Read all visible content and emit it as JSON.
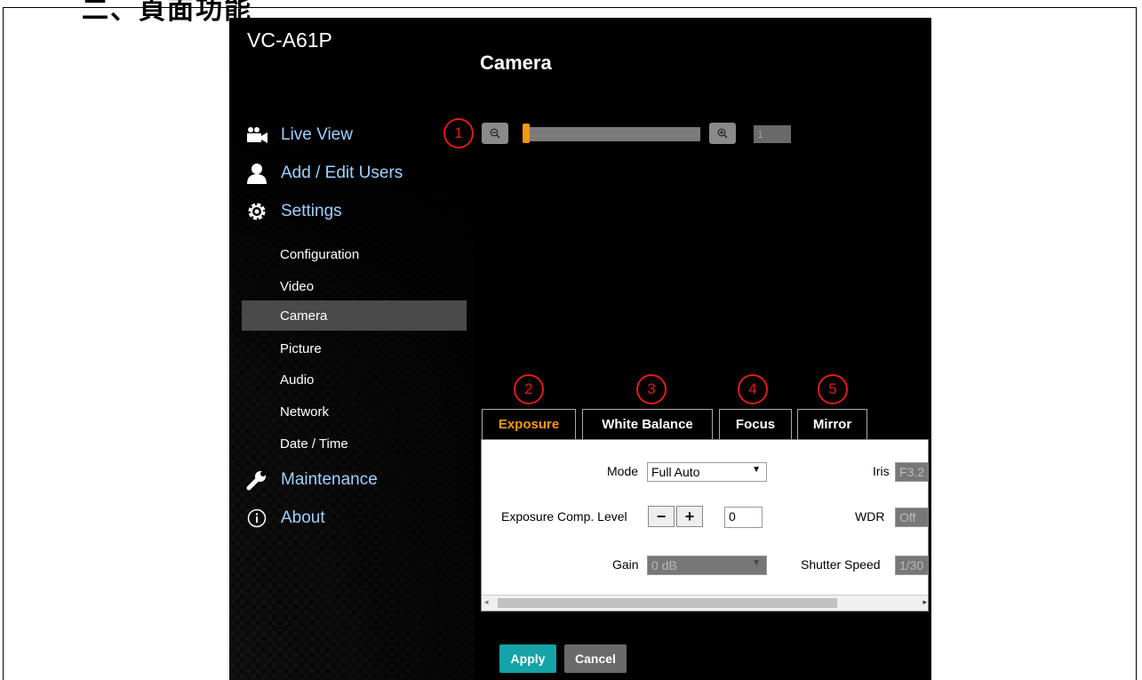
{
  "doc_heading": "二、頁面功能",
  "app": {
    "brand": "VC-A61P",
    "page_title": "Camera",
    "nav": [
      {
        "label": "Live View",
        "icon": "video-camera-icon"
      },
      {
        "label": "Add / Edit Users",
        "icon": "user-icon"
      },
      {
        "label": "Settings",
        "icon": "gear-icon"
      },
      {
        "label": "Maintenance",
        "icon": "wrench-icon"
      },
      {
        "label": "About",
        "icon": "info-icon"
      }
    ],
    "sub_nav": [
      "Configuration",
      "Video",
      "Camera",
      "Picture",
      "Audio",
      "Network",
      "Date / Time"
    ],
    "active_sub": "Camera"
  },
  "zoom": {
    "value": "1",
    "position": 0.0
  },
  "callouts": [
    "1",
    "2",
    "3",
    "4",
    "5"
  ],
  "tabs": [
    "Exposure",
    "White Balance",
    "Focus",
    "Mirror"
  ],
  "active_tab": "Exposure",
  "exposure": {
    "mode_label": "Mode",
    "mode_value": "Full Auto",
    "iris_label": "Iris",
    "iris_value": "F3.2",
    "comp_label": "Exposure Comp. Level",
    "minus_label": "−",
    "plus_label": "+",
    "comp_value": "0",
    "wdr_label": "WDR",
    "wdr_value": "Off",
    "gain_label": "Gain",
    "gain_value": "0 dB",
    "shutter_label": "Shutter Speed",
    "shutter_value": "1/30"
  },
  "buttons": {
    "apply": "Apply",
    "cancel": "Cancel"
  },
  "colors": {
    "accent": "#f29a12",
    "apply": "#14a3a8",
    "link": "#9fd0ff",
    "callout": "#e21b1b"
  }
}
